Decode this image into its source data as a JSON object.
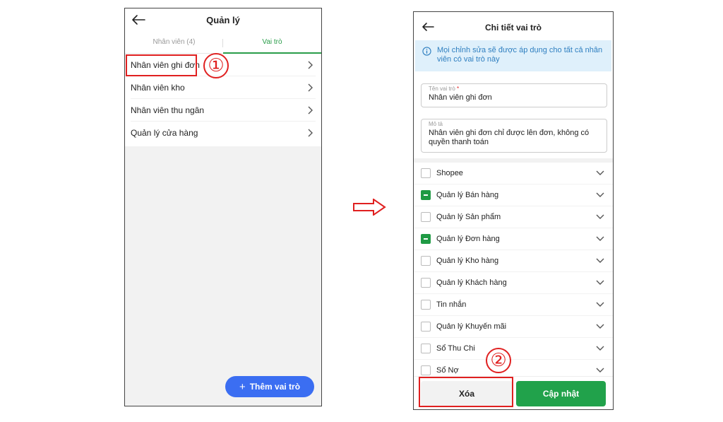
{
  "left_screen": {
    "title": "Quản lý",
    "tabs": [
      {
        "label": "Nhân viên (4)",
        "active": false
      },
      {
        "label": "Vai trò",
        "active": true
      }
    ],
    "roles": [
      "Nhân viên ghi đơn",
      "Nhân viên kho",
      "Nhân viên thu ngân",
      "Quản lý cửa hàng"
    ],
    "add_button": "Thêm vai trò",
    "icons": {
      "back": "arrow-left-icon",
      "chevron": "chevron-right-icon",
      "plus": "plus-icon"
    }
  },
  "annotations": {
    "step1": "①",
    "step2": "②",
    "arrow": "arrow-right-outline-icon",
    "highlight_color": "#e02020"
  },
  "right_screen": {
    "title": "Chi tiết vai trò",
    "info_text": "Mọi chỉnh sửa sẽ được áp dụng cho tất cả nhân viên có vai trò này",
    "role_name_label": "Tên vai trò",
    "role_name_required": "*",
    "role_name_value": "Nhân viên ghi đơn",
    "description_label": "Mô tả",
    "description_value": "Nhân viên ghi đơn chỉ được lên đơn, không có quyền thanh toán",
    "permissions": [
      {
        "label": "Shopee",
        "state": "unchecked"
      },
      {
        "label": "Quản lý Bán hàng",
        "state": "partial"
      },
      {
        "label": "Quản lý Sản phẩm",
        "state": "unchecked"
      },
      {
        "label": "Quản lý Đơn hàng",
        "state": "partial"
      },
      {
        "label": "Quản lý Kho hàng",
        "state": "unchecked"
      },
      {
        "label": "Quản lý Khách hàng",
        "state": "unchecked"
      },
      {
        "label": "Tin nhắn",
        "state": "unchecked"
      },
      {
        "label": "Quản lý Khuyến mãi",
        "state": "unchecked"
      },
      {
        "label": "Sổ Thu Chi",
        "state": "unchecked"
      },
      {
        "label": "Sổ Nợ",
        "state": "unchecked"
      }
    ],
    "delete_button": "Xóa",
    "update_button": "Cập nhật",
    "colors": {
      "primary_green": "#21a24b",
      "info_bg": "#dff0fb",
      "info_text": "#2f7fc0",
      "add_button_blue": "#3b6ef2"
    }
  }
}
